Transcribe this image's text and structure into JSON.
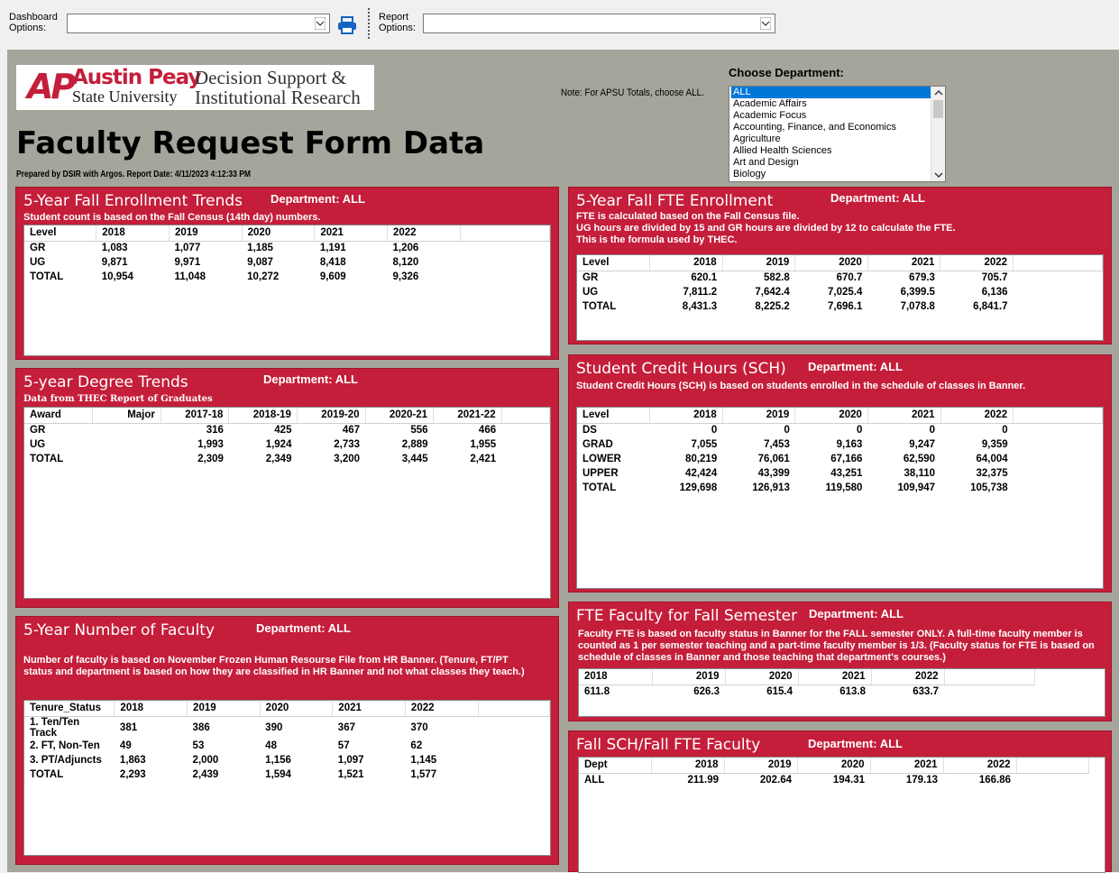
{
  "toolbar": {
    "dashboard_label_1": "Dashboard",
    "dashboard_label_2": "Options:",
    "report_label_1": "Report",
    "report_label_2": "Options:"
  },
  "header": {
    "logo_ap": "AP",
    "logo_austin_peay": "Austin Peay",
    "logo_state_university": "State University",
    "logo_dsir_1": "Decision Support &",
    "logo_dsir_2": "Institutional Research",
    "title": "Faculty Request Form Data",
    "prepared": "Prepared by DSIR with Argos. Report Date:  4/11/2023 4:12:33 PM",
    "note": "Note: For APSU Totals, choose ALL.",
    "choose_label": "Choose Department:",
    "departments": [
      "ALL",
      "Academic Affairs",
      "Academic Focus",
      "Accounting, Finance, and Economics",
      "Agriculture",
      "Allied Health Sciences",
      "Art and Design",
      "Biology"
    ]
  },
  "enroll": {
    "title": "5-Year Fall Enrollment Trends",
    "dept": "Department:  ALL",
    "note": "Student count is based on the Fall Census (14th day) numbers.",
    "headers": [
      "Level",
      "2018",
      "2019",
      "2020",
      "2021",
      "2022"
    ],
    "rows": [
      [
        "GR",
        "1,083",
        "1,077",
        "1,185",
        "1,191",
        "1,206"
      ],
      [
        "UG",
        "9,871",
        "9,971",
        "9,087",
        "8,418",
        "8,120"
      ],
      [
        "TOTAL",
        "10,954",
        "11,048",
        "10,272",
        "9,609",
        "9,326"
      ]
    ]
  },
  "fte": {
    "title": "5-Year Fall FTE Enrollment",
    "dept": "Department:  ALL",
    "note1": "FTE is calculated based on the Fall Census file.",
    "note2": "UG hours are divided by 15 and GR hours are divided by 12 to calculate the FTE.",
    "note3": "This is the formula used by THEC.",
    "headers": [
      "Level",
      "2018",
      "2019",
      "2020",
      "2021",
      "2022"
    ],
    "rows": [
      [
        "GR",
        "620.1",
        "582.8",
        "670.7",
        "679.3",
        "705.7"
      ],
      [
        "UG",
        "7,811.2",
        "7,642.4",
        "7,025.4",
        "6,399.5",
        "6,136"
      ],
      [
        "TOTAL",
        "8,431.3",
        "8,225.2",
        "7,696.1",
        "7,078.8",
        "6,841.7"
      ]
    ]
  },
  "degree": {
    "title": "5-year Degree Trends",
    "dept": "Department:  ALL",
    "note": "Data from THEC Report of Graduates",
    "headers": [
      "Award",
      "Major",
      "2017-18",
      "2018-19",
      "2019-20",
      "2020-21",
      "2021-22"
    ],
    "rows": [
      [
        "GR",
        "",
        "316",
        "425",
        "467",
        "556",
        "466"
      ],
      [
        "UG",
        "",
        "1,993",
        "1,924",
        "2,733",
        "2,889",
        "1,955"
      ],
      [
        "TOTAL",
        "",
        "2,309",
        "2,349",
        "3,200",
        "3,445",
        "2,421"
      ]
    ]
  },
  "sch": {
    "title": "Student Credit Hours (SCH)",
    "dept": "Department: ALL",
    "note": "Student Credit Hours (SCH) is based on students enrolled in the schedule of classes in Banner.",
    "headers": [
      "Level",
      "2018",
      "2019",
      "2020",
      "2021",
      "2022"
    ],
    "rows": [
      [
        "DS",
        "0",
        "0",
        "0",
        "0",
        "0"
      ],
      [
        "GRAD",
        "7,055",
        "7,453",
        "9,163",
        "9,247",
        "9,359"
      ],
      [
        "LOWER",
        "80,219",
        "76,061",
        "67,166",
        "62,590",
        "64,004"
      ],
      [
        "UPPER",
        "42,424",
        "43,399",
        "43,251",
        "38,110",
        "32,375"
      ],
      [
        "TOTAL",
        "129,698",
        "126,913",
        "119,580",
        "109,947",
        "105,738"
      ]
    ]
  },
  "faculty": {
    "title": "5-Year Number of Faculty",
    "dept": "Department: ALL",
    "note": "Number of faculty is based on November Frozen Human Resourse File from HR Banner. (Tenure, FT/PT status and department is based on how they are classified in HR Banner and not what classes they teach.)",
    "headers": [
      "Tenure_Status",
      "2018",
      "2019",
      "2020",
      "2021",
      "2022"
    ],
    "rows": [
      [
        "1. Ten/Ten Track",
        "381",
        "386",
        "390",
        "367",
        "370"
      ],
      [
        "2. FT, Non-Ten",
        "49",
        "53",
        "48",
        "57",
        "62"
      ],
      [
        "3. PT/Adjuncts",
        "1,863",
        "2,000",
        "1,156",
        "1,097",
        "1,145"
      ],
      [
        "TOTAL",
        "2,293",
        "2,439",
        "1,594",
        "1,521",
        "1,577"
      ]
    ]
  },
  "ftefac": {
    "title": "FTE Faculty for Fall Semester",
    "dept": "Department: ALL",
    "note": "Faculty FTE is based on faculty status in Banner for the FALL semester ONLY.  A full-time faculty member is counted as 1 per semester teaching and a part-time faculty member is 1/3. (Faculty status for FTE is based on schedule of classes in Banner and those teaching that department's courses.)",
    "headers": [
      "2018",
      "2019",
      "2020",
      "2021",
      "2022"
    ],
    "rows": [
      [
        "611.8",
        "626.3",
        "615.4",
        "613.8",
        "633.7"
      ]
    ]
  },
  "ratio": {
    "title": "Fall SCH/Fall FTE Faculty",
    "dept": "Department: ALL",
    "headers": [
      "Dept",
      "2018",
      "2019",
      "2020",
      "2021",
      "2022"
    ],
    "rows": [
      [
        "ALL",
        "211.99",
        "202.64",
        "194.31",
        "179.13",
        "166.86"
      ]
    ]
  }
}
